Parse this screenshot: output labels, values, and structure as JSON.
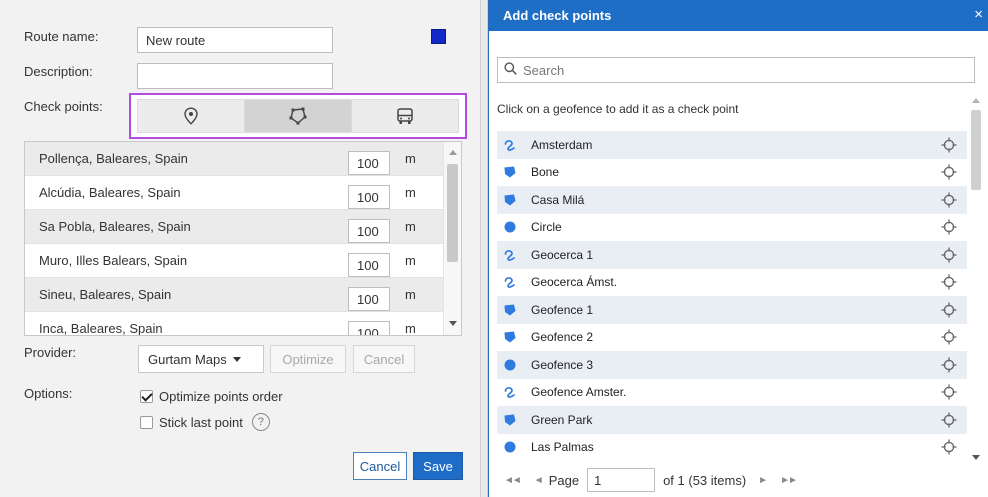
{
  "route_form": {
    "route_name_label": "Route name:",
    "route_name_value": "New route",
    "description_label": "Description:",
    "description_value": "",
    "route_color": "#1428c8",
    "check_points_label": "Check points:",
    "modes": [
      {
        "name": "point",
        "icon": "location-pin-icon",
        "active": false
      },
      {
        "name": "geofence",
        "icon": "polygon-geofence-icon",
        "active": true
      },
      {
        "name": "unit",
        "icon": "bus-icon",
        "active": false
      }
    ],
    "points": [
      {
        "name": "Pollença, Baleares, Spain",
        "radius": "100",
        "unit": "m"
      },
      {
        "name": "Alcúdia, Baleares, Spain",
        "radius": "100",
        "unit": "m"
      },
      {
        "name": "Sa Pobla, Baleares, Spain",
        "radius": "100",
        "unit": "m"
      },
      {
        "name": "Muro, Illes Balears, Spain",
        "radius": "100",
        "unit": "m"
      },
      {
        "name": "Sineu, Baleares, Spain",
        "radius": "100",
        "unit": "m"
      },
      {
        "name": "Inca, Baleares, Spain",
        "radius": "100",
        "unit": "m"
      }
    ],
    "provider_label": "Provider:",
    "provider_value": "Gurtam Maps",
    "optimize_label": "Optimize",
    "cancel_small_label": "Cancel",
    "options_label": "Options:",
    "optimize_points_order_label": "Optimize points order",
    "optimize_points_order_checked": true,
    "stick_last_point_label": "Stick last point",
    "stick_last_point_checked": false,
    "help_glyph": "?",
    "cancel_label": "Cancel",
    "save_label": "Save"
  },
  "dialog": {
    "title": "Add check points",
    "close_glyph": "×",
    "search_placeholder": "Search",
    "hint": "Click on a geofence to add it as a check point",
    "geofences": [
      {
        "name": "Amsterdam",
        "type": "line"
      },
      {
        "name": "Bone",
        "type": "polygon"
      },
      {
        "name": "Casa Milá",
        "type": "polygon"
      },
      {
        "name": "Circle",
        "type": "circle"
      },
      {
        "name": "Geocerca 1",
        "type": "line"
      },
      {
        "name": "Geocerca Ámst.",
        "type": "line"
      },
      {
        "name": "Geofence 1",
        "type": "polygon"
      },
      {
        "name": "Geofence 2",
        "type": "polygon"
      },
      {
        "name": "Geofence 3",
        "type": "circle"
      },
      {
        "name": "Geofence Amster.",
        "type": "line"
      },
      {
        "name": "Green Park",
        "type": "polygon"
      },
      {
        "name": "Las Palmas",
        "type": "circle"
      }
    ],
    "icon_color": "#2f7be0",
    "pager": {
      "page_label": "Page",
      "page_value": "1",
      "of_text": "of 1 (53 items)"
    }
  }
}
